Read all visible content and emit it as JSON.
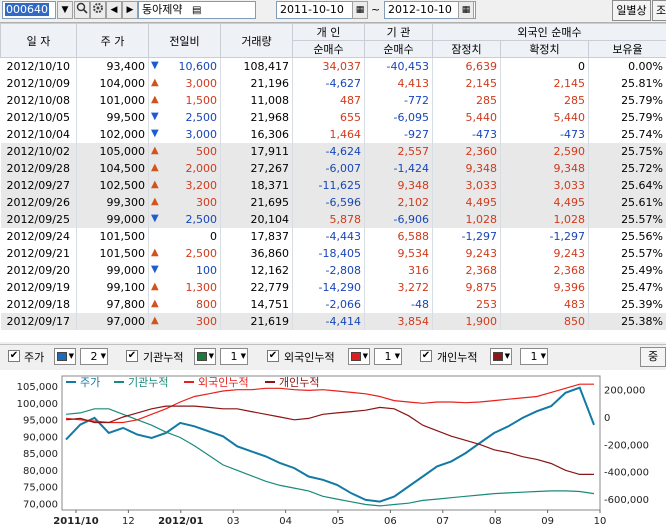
{
  "toolbar": {
    "code": "000640",
    "name": "동아제약",
    "date_from": "2011-10-10",
    "date_to": "2012-10-10",
    "tilde": "~",
    "daily_detail_label": "일별상세",
    "lookup_label": "조"
  },
  "table": {
    "headers": {
      "date": "일 자",
      "price": "주 가",
      "change": "전일비",
      "volume": "거래량",
      "individual": "개 인",
      "institution": "기 관",
      "foreign": "외국인 순매수",
      "net": "순매수",
      "net2": "순매수",
      "tentative": "잠정치",
      "confirmed": "확정치",
      "holding": "보유율"
    },
    "rows": [
      {
        "date": "2012/10/10",
        "price": "93,400",
        "dir": "down",
        "change": "10,600",
        "volume": "108,417",
        "ind": "34,037",
        "inst": "-40,453",
        "ftent": "6,639",
        "fconf": "0",
        "hold": "0.00%",
        "gray": false
      },
      {
        "date": "2012/10/09",
        "price": "104,000",
        "dir": "up",
        "change": "3,000",
        "volume": "21,196",
        "ind": "-4,627",
        "inst": "4,413",
        "ftent": "2,145",
        "fconf": "2,145",
        "hold": "25.81%",
        "gray": false
      },
      {
        "date": "2012/10/08",
        "price": "101,000",
        "dir": "up",
        "change": "1,500",
        "volume": "11,008",
        "ind": "487",
        "inst": "-772",
        "ftent": "285",
        "fconf": "285",
        "hold": "25.79%",
        "gray": false
      },
      {
        "date": "2012/10/05",
        "price": "99,500",
        "dir": "down",
        "change": "2,500",
        "volume": "21,968",
        "ind": "655",
        "inst": "-6,095",
        "ftent": "5,440",
        "fconf": "5,440",
        "hold": "25.79%",
        "gray": false
      },
      {
        "date": "2012/10/04",
        "price": "102,000",
        "dir": "down",
        "change": "3,000",
        "volume": "16,306",
        "ind": "1,464",
        "inst": "-927",
        "ftent": "-473",
        "fconf": "-473",
        "hold": "25.74%",
        "gray": false
      },
      {
        "date": "2012/10/02",
        "price": "105,000",
        "dir": "up",
        "change": "500",
        "volume": "17,911",
        "ind": "-4,624",
        "inst": "2,557",
        "ftent": "2,360",
        "fconf": "2,590",
        "hold": "25.75%",
        "gray": true
      },
      {
        "date": "2012/09/28",
        "price": "104,500",
        "dir": "up",
        "change": "2,000",
        "volume": "27,267",
        "ind": "-6,007",
        "inst": "-1,424",
        "ftent": "9,348",
        "fconf": "9,348",
        "hold": "25.72%",
        "gray": true
      },
      {
        "date": "2012/09/27",
        "price": "102,500",
        "dir": "up",
        "change": "3,200",
        "volume": "18,371",
        "ind": "-11,625",
        "inst": "9,348",
        "ftent": "3,033",
        "fconf": "3,033",
        "hold": "25.64%",
        "gray": true
      },
      {
        "date": "2012/09/26",
        "price": "99,300",
        "dir": "up",
        "change": "300",
        "volume": "21,695",
        "ind": "-6,596",
        "inst": "2,102",
        "ftent": "4,495",
        "fconf": "4,495",
        "hold": "25.61%",
        "gray": true
      },
      {
        "date": "2012/09/25",
        "price": "99,000",
        "dir": "down",
        "change": "2,500",
        "volume": "20,104",
        "ind": "5,878",
        "inst": "-6,906",
        "ftent": "1,028",
        "fconf": "1,028",
        "hold": "25.57%",
        "gray": true
      },
      {
        "date": "2012/09/24",
        "price": "101,500",
        "dir": "none",
        "change": "0",
        "volume": "17,837",
        "ind": "-4,443",
        "inst": "6,588",
        "ftent": "-1,297",
        "fconf": "-1,297",
        "hold": "25.56%",
        "gray": false
      },
      {
        "date": "2012/09/21",
        "price": "101,500",
        "dir": "up",
        "change": "2,500",
        "volume": "36,860",
        "ind": "-18,405",
        "inst": "9,534",
        "ftent": "9,243",
        "fconf": "9,243",
        "hold": "25.57%",
        "gray": false
      },
      {
        "date": "2012/09/20",
        "price": "99,000",
        "dir": "down",
        "change": "100",
        "volume": "12,162",
        "ind": "-2,808",
        "inst": "316",
        "ftent": "2,368",
        "fconf": "2,368",
        "hold": "25.49%",
        "gray": false
      },
      {
        "date": "2012/09/19",
        "price": "99,100",
        "dir": "up",
        "change": "1,300",
        "volume": "22,779",
        "ind": "-14,290",
        "inst": "3,272",
        "ftent": "9,875",
        "fconf": "9,396",
        "hold": "25.47%",
        "gray": false
      },
      {
        "date": "2012/09/18",
        "price": "97,800",
        "dir": "up",
        "change": "800",
        "volume": "14,751",
        "ind": "-2,066",
        "inst": "-48",
        "ftent": "253",
        "fconf": "483",
        "hold": "25.39%",
        "gray": false
      },
      {
        "date": "2012/09/17",
        "price": "97,000",
        "dir": "up",
        "change": "300",
        "volume": "21,619",
        "ind": "-4,414",
        "inst": "3,854",
        "ftent": "1,900",
        "fconf": "850",
        "hold": "25.38%",
        "gray": true
      }
    ]
  },
  "controls": {
    "price_label": "주가",
    "price_color": "#1e6bb8",
    "price_width": "2",
    "inst_label": "기관누적",
    "inst_color": "#1e7a3a",
    "inst_width": "1",
    "foreign_label": "외국인누적",
    "foreign_color": "#e02020",
    "foreign_width": "1",
    "ind_label": "개인누적",
    "ind_color": "#8b1a1a",
    "ind_width": "1",
    "apply_label": "중"
  },
  "chart_data": {
    "type": "line",
    "legend": [
      "주가",
      "기관누적",
      "외국인누적",
      "개인누적"
    ],
    "colors": {
      "price": "#127aa4",
      "inst": "#1a8a7a",
      "foreign": "#e8201c",
      "ind": "#8b1414"
    },
    "x_ticks": [
      "2011/10",
      "12",
      "2012/01",
      "03",
      "04",
      "05",
      "06",
      "07",
      "08",
      "09",
      "10"
    ],
    "y_left_ticks": [
      "105,000",
      "100,000",
      "95,000",
      "90,000",
      "85,000",
      "80,000",
      "75,000",
      "70,000"
    ],
    "y_left_range": [
      68000,
      108000
    ],
    "y_right_ticks": [
      "200,000",
      "0",
      "-200,000",
      "-400,000",
      "-600,000"
    ],
    "y_right_range": [
      -680000,
      300000
    ],
    "series": [
      {
        "name": "주가",
        "key": "price",
        "axis": "left",
        "values": [
          89000,
          93500,
          95500,
          91000,
          92500,
          90500,
          89500,
          91000,
          94000,
          93000,
          91500,
          90000,
          87000,
          85500,
          84000,
          82000,
          80500,
          78000,
          77000,
          75500,
          73000,
          71000,
          70500,
          72000,
          75000,
          78000,
          81000,
          82500,
          85000,
          88000,
          91000,
          93000,
          95500,
          97500,
          99000,
          103000,
          104500,
          93400
        ]
      },
      {
        "name": "기관누적",
        "key": "inst",
        "axis": "right",
        "values": [
          20000,
          30000,
          60000,
          60000,
          20000,
          -20000,
          -60000,
          -110000,
          -150000,
          -210000,
          -280000,
          -350000,
          -390000,
          -430000,
          -470000,
          -500000,
          -520000,
          -540000,
          -580000,
          -600000,
          -620000,
          -640000,
          -650000,
          -640000,
          -630000,
          -610000,
          -600000,
          -590000,
          -580000,
          -570000,
          -560000,
          -555000,
          -550000,
          -545000,
          -540000,
          -540000,
          -545000,
          -560000
        ]
      },
      {
        "name": "외국인누적",
        "key": "foreign",
        "axis": "right",
        "values": [
          -10000,
          -20000,
          -30000,
          -40000,
          -40000,
          -20000,
          20000,
          60000,
          110000,
          150000,
          170000,
          190000,
          200000,
          200000,
          210000,
          210000,
          200000,
          195000,
          200000,
          190000,
          180000,
          170000,
          150000,
          120000,
          110000,
          100000,
          110000,
          110000,
          105000,
          110000,
          120000,
          130000,
          140000,
          150000,
          180000,
          210000,
          240000,
          240000
        ]
      },
      {
        "name": "개인누적",
        "key": "ind",
        "axis": "right",
        "values": [
          -20000,
          -10000,
          -40000,
          -40000,
          0,
          30000,
          60000,
          80000,
          80000,
          80000,
          70000,
          60000,
          60000,
          40000,
          20000,
          0,
          -20000,
          -10000,
          20000,
          30000,
          40000,
          50000,
          70000,
          60000,
          10000,
          -60000,
          -100000,
          -140000,
          -170000,
          -200000,
          -240000,
          -260000,
          -290000,
          -310000,
          -340000,
          -390000,
          -420000,
          -420000
        ]
      }
    ]
  }
}
